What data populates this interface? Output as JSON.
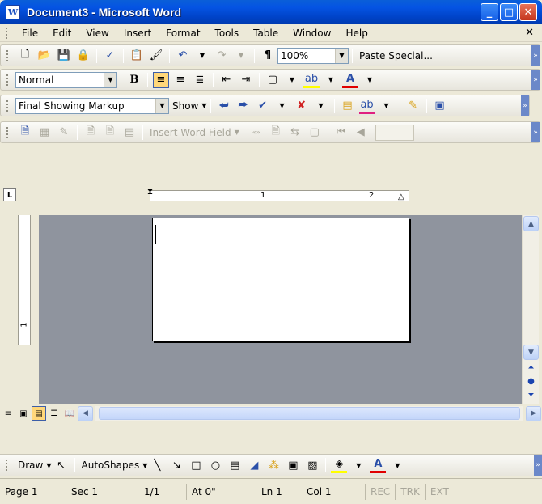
{
  "window": {
    "title": "Document3 - Microsoft Word",
    "app_icon": "W"
  },
  "menu": [
    "File",
    "Edit",
    "View",
    "Insert",
    "Format",
    "Tools",
    "Table",
    "Window",
    "Help"
  ],
  "standard_toolbar": {
    "zoom": "100%",
    "paste_special": "Paste Special..."
  },
  "formatting_toolbar": {
    "style": "Normal"
  },
  "reviewing_toolbar": {
    "display_for_review": "Final Showing Markup",
    "show_label": "Show"
  },
  "mail_merge_toolbar": {
    "insert_word_field": "Insert Word Field"
  },
  "ruler": {
    "marks": [
      "1",
      "2"
    ],
    "vertical_mark": "1"
  },
  "drawing_toolbar": {
    "draw_label": "Draw",
    "autoshapes_label": "AutoShapes"
  },
  "status_bar": {
    "page": "Page 1",
    "sec": "Sec 1",
    "pages": "1/1",
    "at": "At 0\"",
    "ln": "Ln 1",
    "col": "Col 1",
    "rec": "REC",
    "trk": "TRK",
    "ext": "EXT"
  }
}
